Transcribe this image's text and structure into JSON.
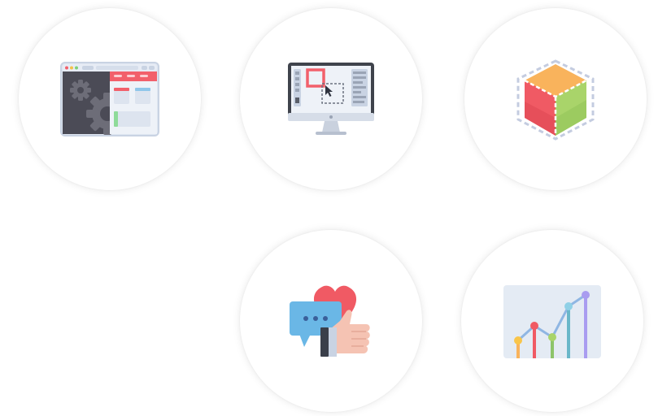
{
  "tiles": [
    {
      "icon": "settings-dashboard-icon"
    },
    {
      "icon": "design-monitor-icon"
    },
    {
      "icon": "3d-cube-icon"
    },
    {
      "icon": "feedback-like-icon"
    },
    {
      "icon": "growth-chart-icon"
    }
  ]
}
